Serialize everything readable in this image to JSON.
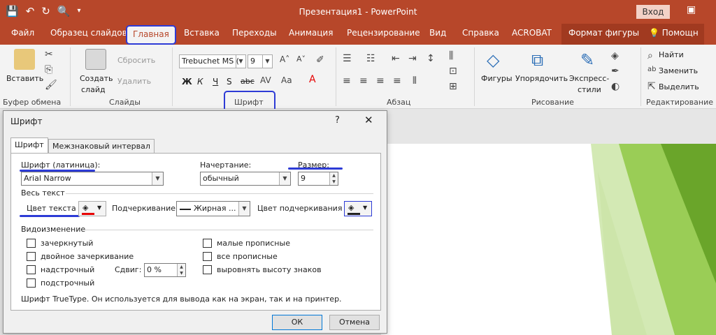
{
  "window": {
    "title": "Презентация1  -  PowerPoint",
    "signin": "Вход"
  },
  "tabs": [
    "Файл",
    "Образец слайдов",
    "Главная",
    "Вставка",
    "Переходы",
    "Анимация",
    "Рецензирование",
    "Вид",
    "Справка",
    "ACROBAT",
    "Формат фигуры",
    "Помощн"
  ],
  "ribbon": {
    "clipboard": {
      "paste": "Вставить",
      "label": "Буфер обмена"
    },
    "slides": {
      "new_slide_1": "Создать",
      "new_slide_2": "слайд",
      "reset": "Сбросить",
      "delete": "Удалить",
      "label": "Слайды"
    },
    "font": {
      "font_name": "Trebuchet MS (",
      "font_size": "9",
      "label": "Шрифт",
      "bold": "Ж",
      "italic": "К",
      "underline": "Ч",
      "strike": "S",
      "strike_text": "abc"
    },
    "paragraph": {
      "label": "Абзац"
    },
    "drawing": {
      "shapes": "Фигуры",
      "arrange": "Упорядочить",
      "quick_styles_1": "Экспресс-",
      "quick_styles_2": "стили",
      "label": "Рисование"
    },
    "editing": {
      "find": "Найти",
      "replace": "Заменить",
      "select": "Выделить",
      "label": "Редактирование"
    }
  },
  "dialog": {
    "title": "Шрифт",
    "help": "?",
    "close": "✕",
    "tabs": [
      "Шрифт",
      "Межзнаковый интервал"
    ],
    "font_latin_label": "Шрифт (латиница):",
    "font_latin_value": "Arial Narrow",
    "style_label": "Начертание:",
    "style_value": "обычный",
    "size_label": "Размер:",
    "size_value": "9",
    "all_text_label": "Весь текст",
    "text_color_label": "Цвет текста",
    "underline_label": "Подчеркивание",
    "underline_value": "Жирная ...",
    "underline_color_label": "Цвет подчеркивания",
    "effects_label": "Видоизменение",
    "effects_left": [
      "зачеркнутый",
      "двойное зачеркивание",
      "надстрочный",
      "подстрочный"
    ],
    "effects_right": [
      "малые прописные",
      "все прописные",
      "выровнять высоту знаков"
    ],
    "offset_label": "Сдвиг:",
    "offset_value": "0 %",
    "info": "Шрифт TrueType. Он используется для вывода как на экран, так и на принтер.",
    "ok": "ОК",
    "cancel": "Отмена"
  },
  "colors": {
    "accent": "#b7472a",
    "highlight": "#2d3bd6",
    "slide_green": "#7dbb2c",
    "text_color_swatch": "#e60000"
  }
}
